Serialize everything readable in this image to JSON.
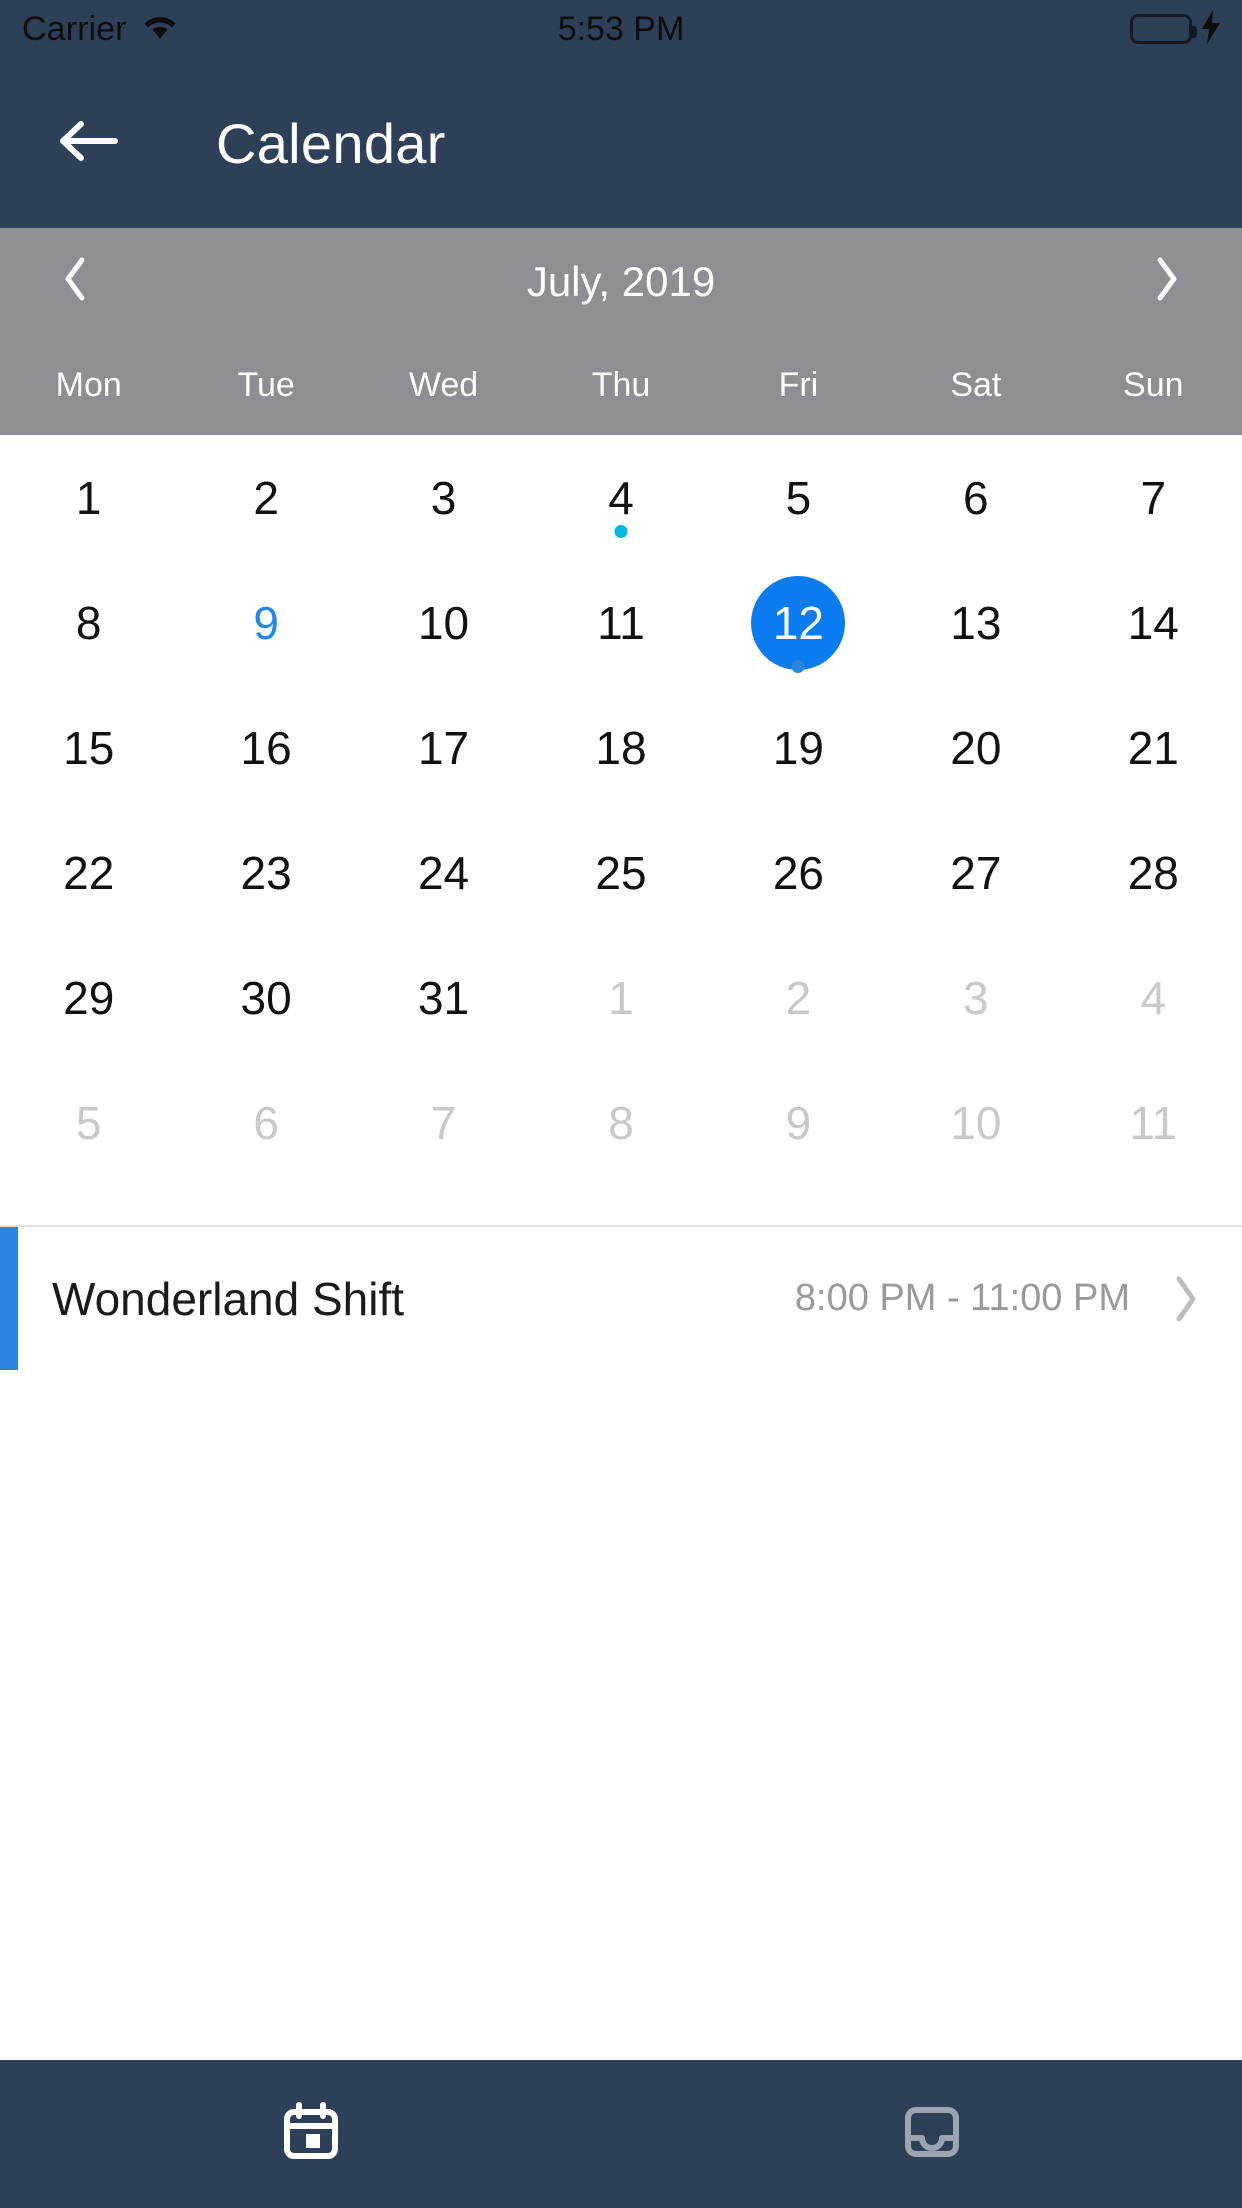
{
  "statusbar": {
    "carrier": "Carrier",
    "time": "5:53 PM",
    "wifi_icon": "wifi-icon",
    "battery_icon": "battery-full-icon",
    "charging_icon": "lightning-bolt-icon"
  },
  "header": {
    "title": "Calendar",
    "back_icon": "arrow-left-icon"
  },
  "monthbar": {
    "label": "July, 2019",
    "prev_icon": "chevron-left-icon",
    "next_icon": "chevron-right-icon"
  },
  "weekdays": [
    "Mon",
    "Tue",
    "Wed",
    "Thu",
    "Fri",
    "Sat",
    "Sun"
  ],
  "calendar": {
    "month": "July",
    "year": "2019",
    "selected_day": "12",
    "today": "9",
    "days": [
      {
        "label": "1",
        "other": false,
        "dot": null
      },
      {
        "label": "2",
        "other": false,
        "dot": null
      },
      {
        "label": "3",
        "other": false,
        "dot": null
      },
      {
        "label": "4",
        "other": false,
        "dot": "cyan"
      },
      {
        "label": "5",
        "other": false,
        "dot": null
      },
      {
        "label": "6",
        "other": false,
        "dot": null
      },
      {
        "label": "7",
        "other": false,
        "dot": null
      },
      {
        "label": "8",
        "other": false,
        "dot": null
      },
      {
        "label": "9",
        "other": false,
        "dot": null,
        "today": true
      },
      {
        "label": "10",
        "other": false,
        "dot": null
      },
      {
        "label": "11",
        "other": false,
        "dot": null
      },
      {
        "label": "12",
        "other": false,
        "dot": "blue",
        "selected": true
      },
      {
        "label": "13",
        "other": false,
        "dot": null
      },
      {
        "label": "14",
        "other": false,
        "dot": null
      },
      {
        "label": "15",
        "other": false,
        "dot": null
      },
      {
        "label": "16",
        "other": false,
        "dot": null
      },
      {
        "label": "17",
        "other": false,
        "dot": null
      },
      {
        "label": "18",
        "other": false,
        "dot": null
      },
      {
        "label": "19",
        "other": false,
        "dot": null
      },
      {
        "label": "20",
        "other": false,
        "dot": null
      },
      {
        "label": "21",
        "other": false,
        "dot": null
      },
      {
        "label": "22",
        "other": false,
        "dot": null
      },
      {
        "label": "23",
        "other": false,
        "dot": null
      },
      {
        "label": "24",
        "other": false,
        "dot": null
      },
      {
        "label": "25",
        "other": false,
        "dot": null
      },
      {
        "label": "26",
        "other": false,
        "dot": null
      },
      {
        "label": "27",
        "other": false,
        "dot": null
      },
      {
        "label": "28",
        "other": false,
        "dot": null
      },
      {
        "label": "29",
        "other": false,
        "dot": null
      },
      {
        "label": "30",
        "other": false,
        "dot": null
      },
      {
        "label": "31",
        "other": false,
        "dot": null
      },
      {
        "label": "1",
        "other": true,
        "dot": null
      },
      {
        "label": "2",
        "other": true,
        "dot": null
      },
      {
        "label": "3",
        "other": true,
        "dot": null
      },
      {
        "label": "4",
        "other": true,
        "dot": null
      },
      {
        "label": "5",
        "other": true,
        "dot": null
      },
      {
        "label": "6",
        "other": true,
        "dot": null
      },
      {
        "label": "7",
        "other": true,
        "dot": null
      },
      {
        "label": "8",
        "other": true,
        "dot": null
      },
      {
        "label": "9",
        "other": true,
        "dot": null
      },
      {
        "label": "10",
        "other": true,
        "dot": null
      },
      {
        "label": "11",
        "other": true,
        "dot": null
      }
    ]
  },
  "events": [
    {
      "title": "Wonderland Shift",
      "time": "8:00 PM - 11:00 PM",
      "accent_color": "#2a85e0",
      "chevron_icon": "chevron-right-icon"
    }
  ],
  "tabbar": {
    "tabs": [
      {
        "icon": "calendar-icon",
        "active": true
      },
      {
        "icon": "inbox-icon",
        "active": false
      }
    ]
  },
  "colors": {
    "header_bg": "#2e4057",
    "monthbar_bg": "#8e8f94",
    "selected_day": "#0a7cf0",
    "today_text": "#1f87f0",
    "event_dot_cyan": "#00b8d9",
    "event_dot_blue": "#2a85e0",
    "battery_green": "#4cd964",
    "other_month_text": "#c9c9c9"
  }
}
